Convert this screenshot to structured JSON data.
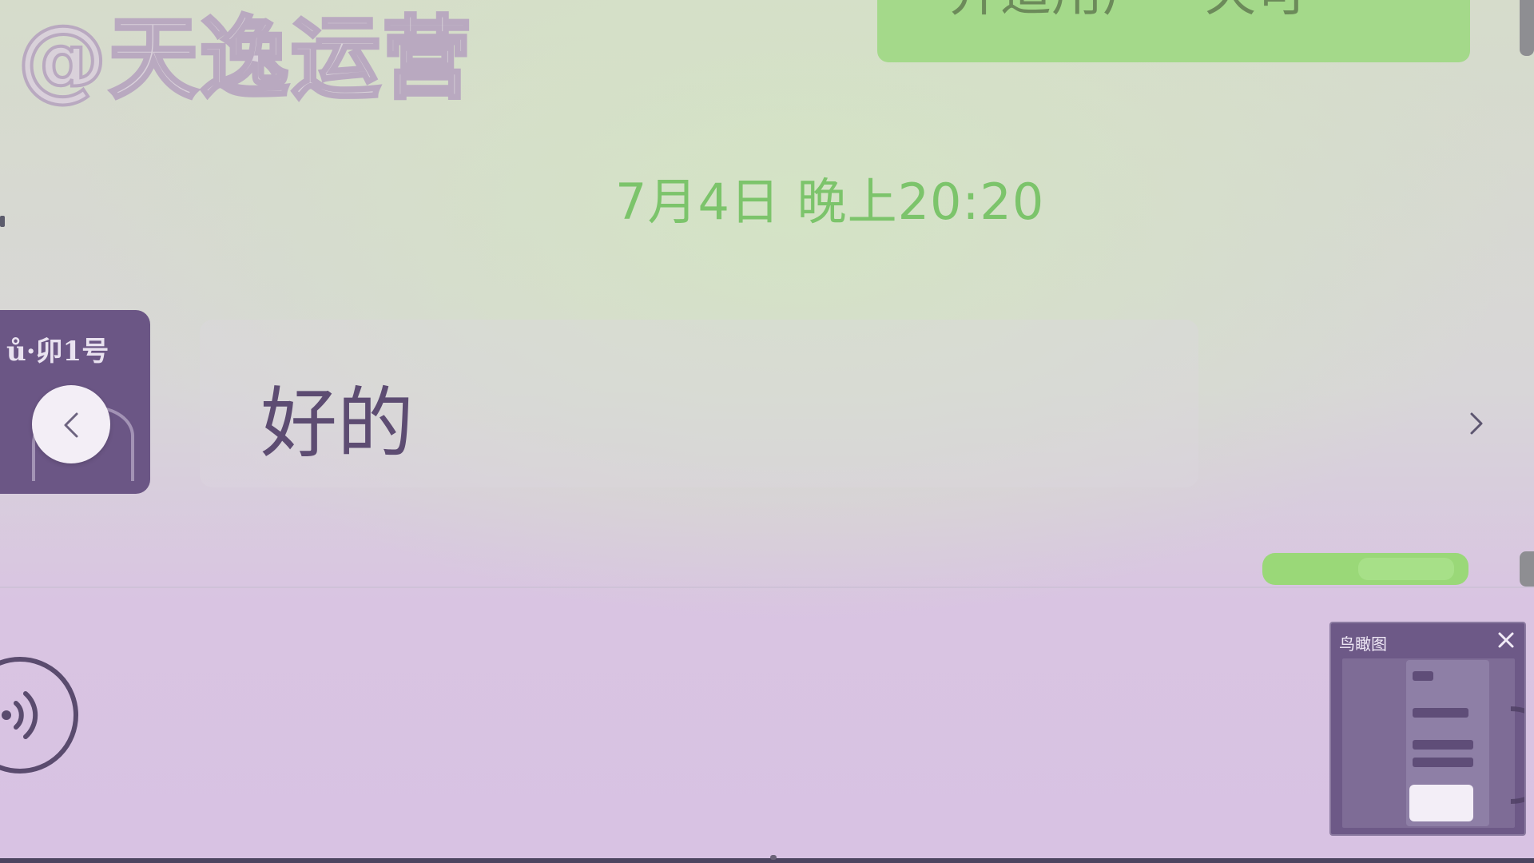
{
  "watermark": {
    "text": "@天逸运营"
  },
  "chat": {
    "timestamp": "7月4日 晚上20:20",
    "received_message": "好的",
    "top_message_partial": "并适用户一天可"
  },
  "floating_window": {
    "title": "鸟瞰图",
    "close_icon": "close-icon"
  },
  "icons": {
    "prev": "chevron-left-icon",
    "next": "chevron-right-icon",
    "voice": "voice-icon"
  },
  "colors": {
    "accent_green": "#a4d98a",
    "timestamp_green": "#7cc46b",
    "text_purple": "#5d4c72",
    "overlay_purple": "#6d5987"
  }
}
